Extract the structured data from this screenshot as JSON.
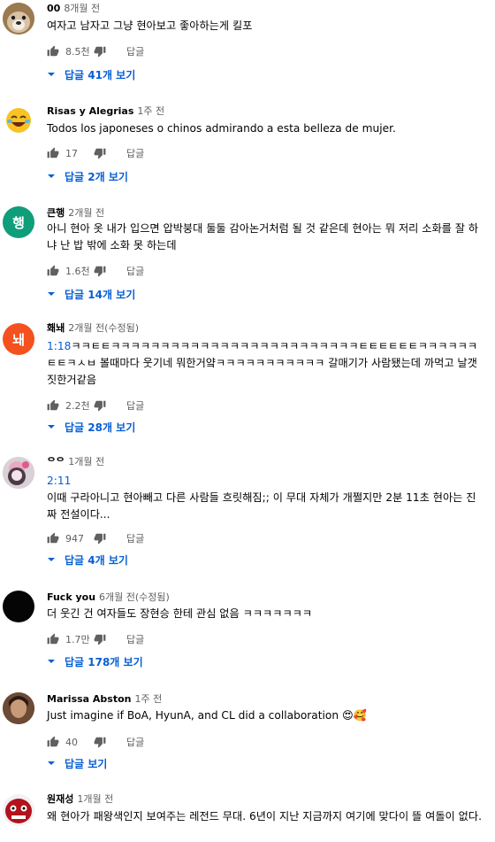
{
  "comments": [
    {
      "author": "00",
      "time": "8개월 전",
      "body": "여자고 남자고 그냥 현아보고 좋아하는게 킬포",
      "likes": "8.5천",
      "reply_label": "답글",
      "view_replies": "답글 41개 보기",
      "avatar": {
        "icon": "dog-photo-avatar",
        "color": "#b38b5d",
        "initial": ""
      }
    },
    {
      "author": "Risas y Alegrias",
      "time": "1주 전",
      "body": "Todos los japoneses o chinos admirando a esta belleza de mujer.",
      "likes": "17",
      "reply_label": "답글",
      "view_replies": "답글 2개 보기",
      "avatar": {
        "icon": "laughing-emoji-avatar",
        "color": "#f7c325",
        "initial": ""
      }
    },
    {
      "author": "큰행",
      "time": "2개월 전",
      "body": "아니 현아 옷 내가 입으면 압박붕대 둘둘 감아논거처럼 될 것 같은데 현아는 뭐 저리 소화를 잘 하냐 난 밥 밖에 소화 못 하는데",
      "likes": "1.6천",
      "reply_label": "답글",
      "view_replies": "답글 14개 보기",
      "avatar": {
        "icon": "letter-avatar",
        "color": "#0f9d7a",
        "initial": "행"
      }
    },
    {
      "author": "홰놰",
      "time": "2개월 전(수정됨)",
      "timestamp": "1:18",
      "body": "ㅋㅋㅌㅌㅋㅋㅋㅋㅋㅋㅋㅋㅋㅋㅋㅋㅋㅋㅋㅋㅋㅋㅋㅋㅋㅋㅋㅋㅋㅌㅌㅌㅌㅌㅌㅋㅋㅋㅋㅋㅋㅌㅌㅋㅅㅂ 볼때마다 웃기네 뭐한거얔ㅋㅋㅋㅋㅋㅋㅋㅋㅋㅋㅋ 갈매기가 사람됐는데 까먹고 날갯짓한거같음",
      "likes": "2.2천",
      "reply_label": "답글",
      "view_replies": "답글 28개 보기",
      "avatar": {
        "icon": "letter-avatar",
        "color": "#f4511e",
        "initial": "놰"
      }
    },
    {
      "author": "ᄋᄋ",
      "time": "1개월 전",
      "timestamp": "2:11",
      "body": "이때 구라아니고 현아빼고 다른 사람들 흐릿해짐;; 이 무대 자체가 개쩔지만 2분 11초 현아는 진짜 전설이다...",
      "likes": "947",
      "reply_label": "답글",
      "view_replies": "답글 4개 보기",
      "avatar": {
        "icon": "character-photo-avatar",
        "color": "#c9c2c6",
        "initial": ""
      }
    },
    {
      "author": "Fuck you",
      "time": "6개월 전(수정됨)",
      "body": "더 웃긴 건 여자들도 장현승 한테 관심 없음 ㅋㅋㅋㅋㅋㅋㅋ",
      "likes": "1.7만",
      "reply_label": "답글",
      "view_replies": "답글 178개 보기",
      "avatar": {
        "icon": "black-avatar",
        "color": "#050505",
        "initial": ""
      }
    },
    {
      "author": "Marissa Abston",
      "time": "1주 전",
      "body": "Just imagine if BoA, HyunA, and CL did a collaboration 😍🥰",
      "likes": "40",
      "reply_label": "답글",
      "view_replies": "답글 보기",
      "avatar": {
        "icon": "person-photo-avatar",
        "color": "#8a6a55",
        "initial": ""
      }
    },
    {
      "author": "원재성",
      "time": "1개월 전",
      "body": "왜 현아가 패왕색인지 보여주는 레전드 무대. 6년이 지난 지금까지 여기에 맞다이 뜰 여돌이 없다.",
      "likes": "",
      "reply_label": "",
      "view_replies": "",
      "avatar": {
        "icon": "mask-photo-avatar",
        "color": "#b3121d",
        "initial": ""
      }
    }
  ]
}
